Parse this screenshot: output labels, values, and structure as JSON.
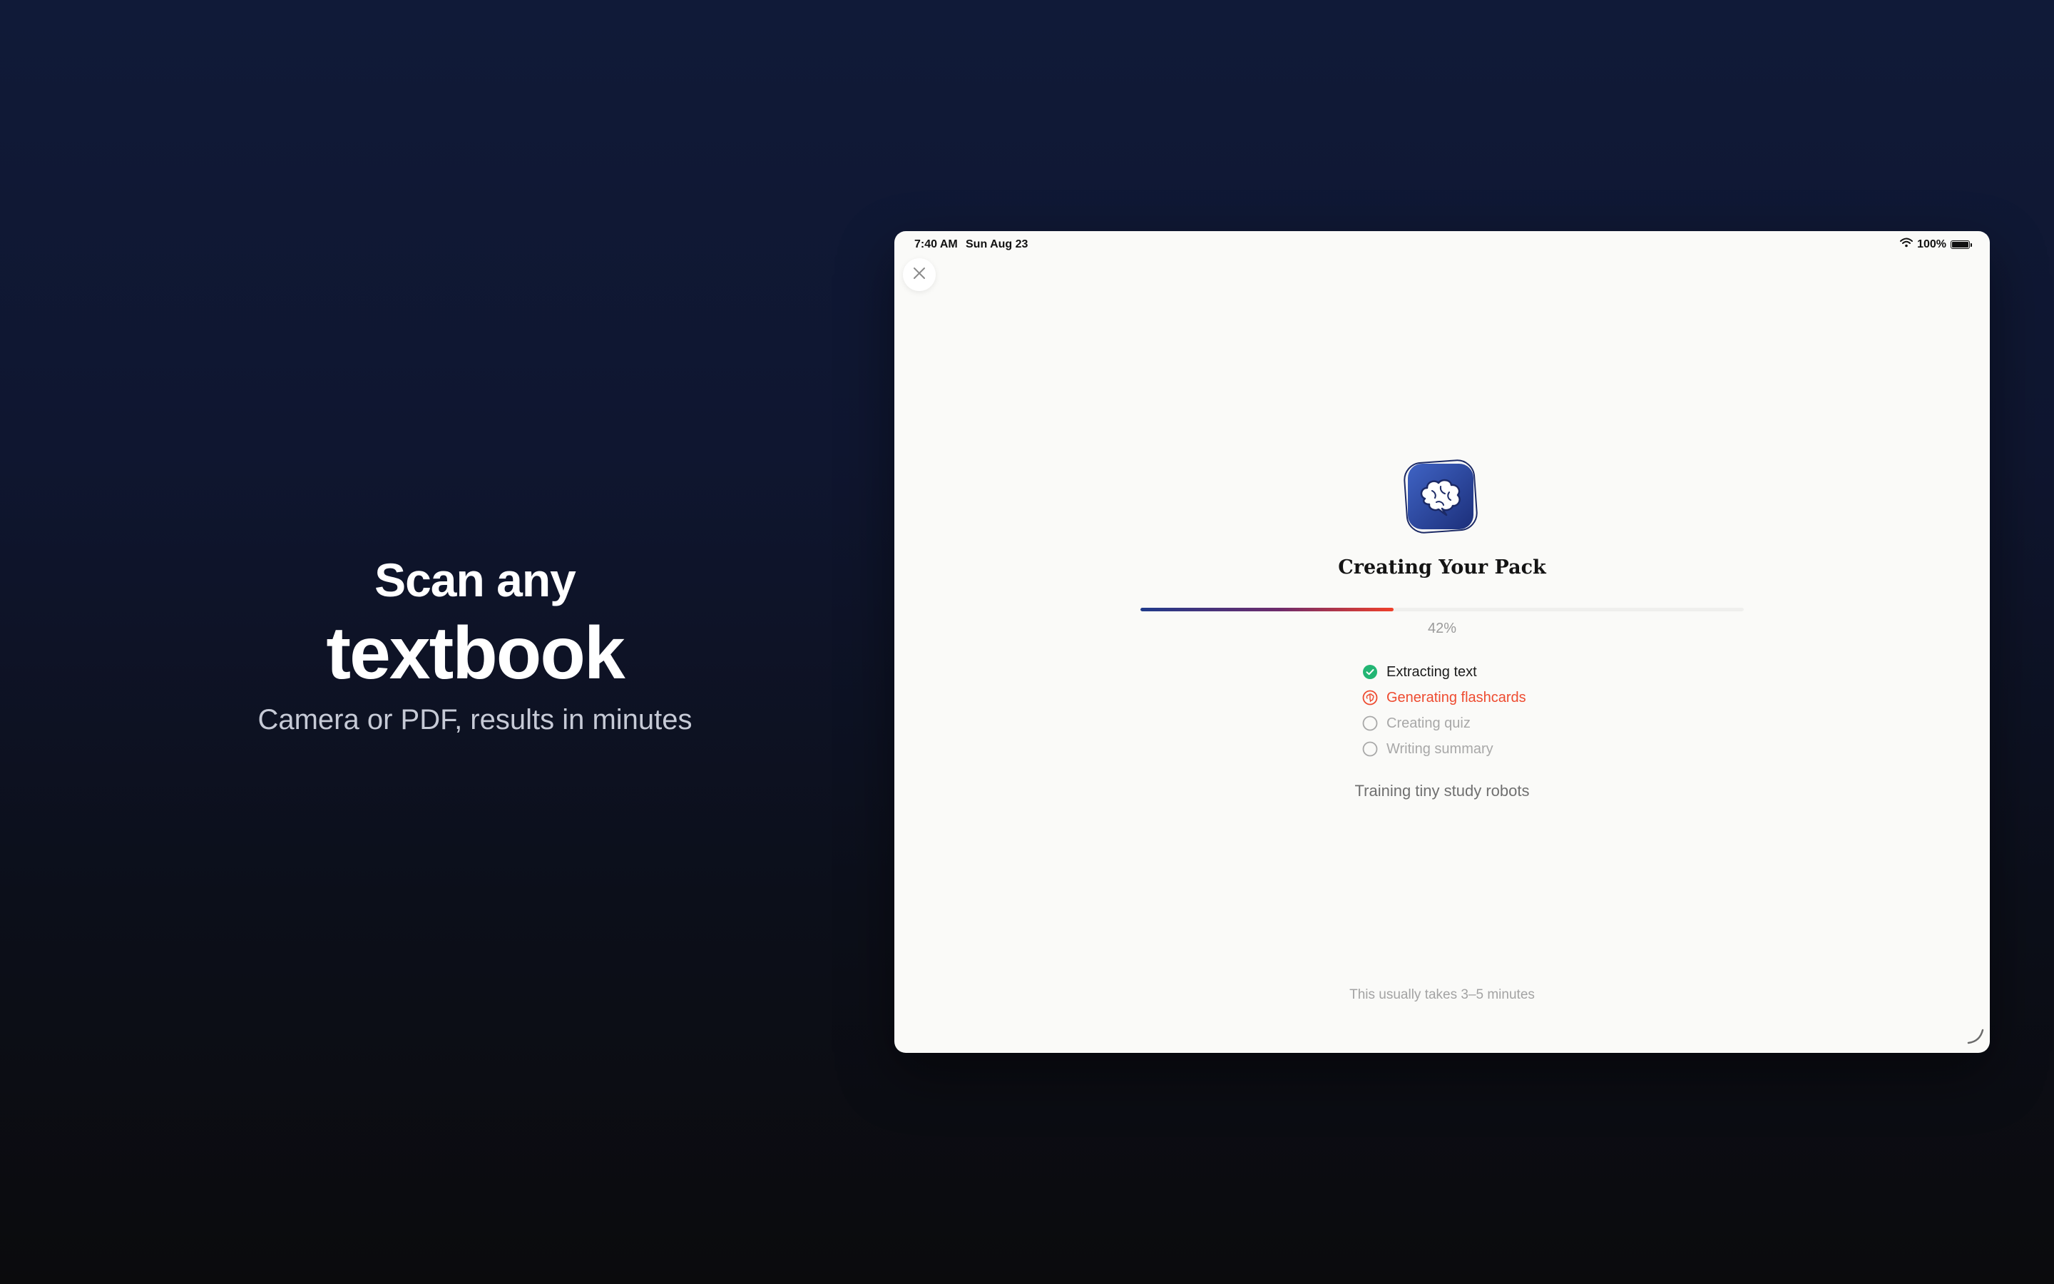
{
  "promo": {
    "line1": "Scan any",
    "line2": "textbook",
    "line3": "Camera or PDF, results in minutes"
  },
  "status_bar": {
    "time": "7:40 AM",
    "date": "Sun Aug 23",
    "battery": "100%",
    "wifi_icon": "wifi-icon",
    "battery_icon": "battery-icon"
  },
  "screen": {
    "close_icon": "close-icon",
    "app_icon": "brain-icon",
    "title": "Creating Your Pack",
    "progress": 0.42,
    "progress_label": "42%",
    "steps": [
      {
        "label": "Extracting text",
        "state": "done"
      },
      {
        "label": "Generating flashcards",
        "state": "active"
      },
      {
        "label": "Creating quiz",
        "state": "pending"
      },
      {
        "label": "Writing summary",
        "state": "pending"
      }
    ],
    "message": "Training tiny study robots",
    "footnote": "This usually takes 3–5 minutes"
  },
  "colors": {
    "background_top": "#101a38",
    "background_bottom": "#0b0b0d",
    "done": "#22b573",
    "active": "#ee4b30",
    "pending": "#a8a8a8",
    "progress_start": "#1f3a8a",
    "progress_end": "#f0402a",
    "icon_blue": "#2b4aa0"
  }
}
